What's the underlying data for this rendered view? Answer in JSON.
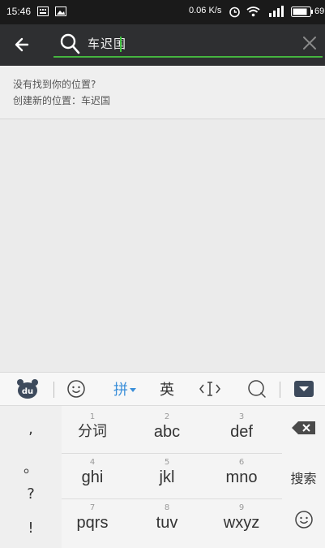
{
  "status": {
    "time": "15:46",
    "speed": "0.06 K/s",
    "battery": "69"
  },
  "search": {
    "query": "车迟国"
  },
  "suggestion": {
    "line1": "没有找到你的位置?",
    "line2": "创建新的位置：车迟国"
  },
  "toolbar": {
    "pinyin": "拼",
    "english": "英"
  },
  "keyboard": {
    "left_keys": [
      ",",
      "。",
      "?",
      "!"
    ],
    "rows": [
      [
        {
          "num": "1",
          "label": "分词"
        },
        {
          "num": "2",
          "label": "abc"
        },
        {
          "num": "3",
          "label": "def"
        }
      ],
      [
        {
          "num": "4",
          "label": "ghi"
        },
        {
          "num": "5",
          "label": "jkl"
        },
        {
          "num": "6",
          "label": "mno"
        }
      ],
      [
        {
          "num": "7",
          "label": "pqrs"
        },
        {
          "num": "8",
          "label": "tuv"
        },
        {
          "num": "9",
          "label": "wxyz"
        }
      ]
    ],
    "search_key": "搜索"
  },
  "colors": {
    "accent_green": "#45b53f",
    "pinyin_blue": "#3b8fd9"
  }
}
